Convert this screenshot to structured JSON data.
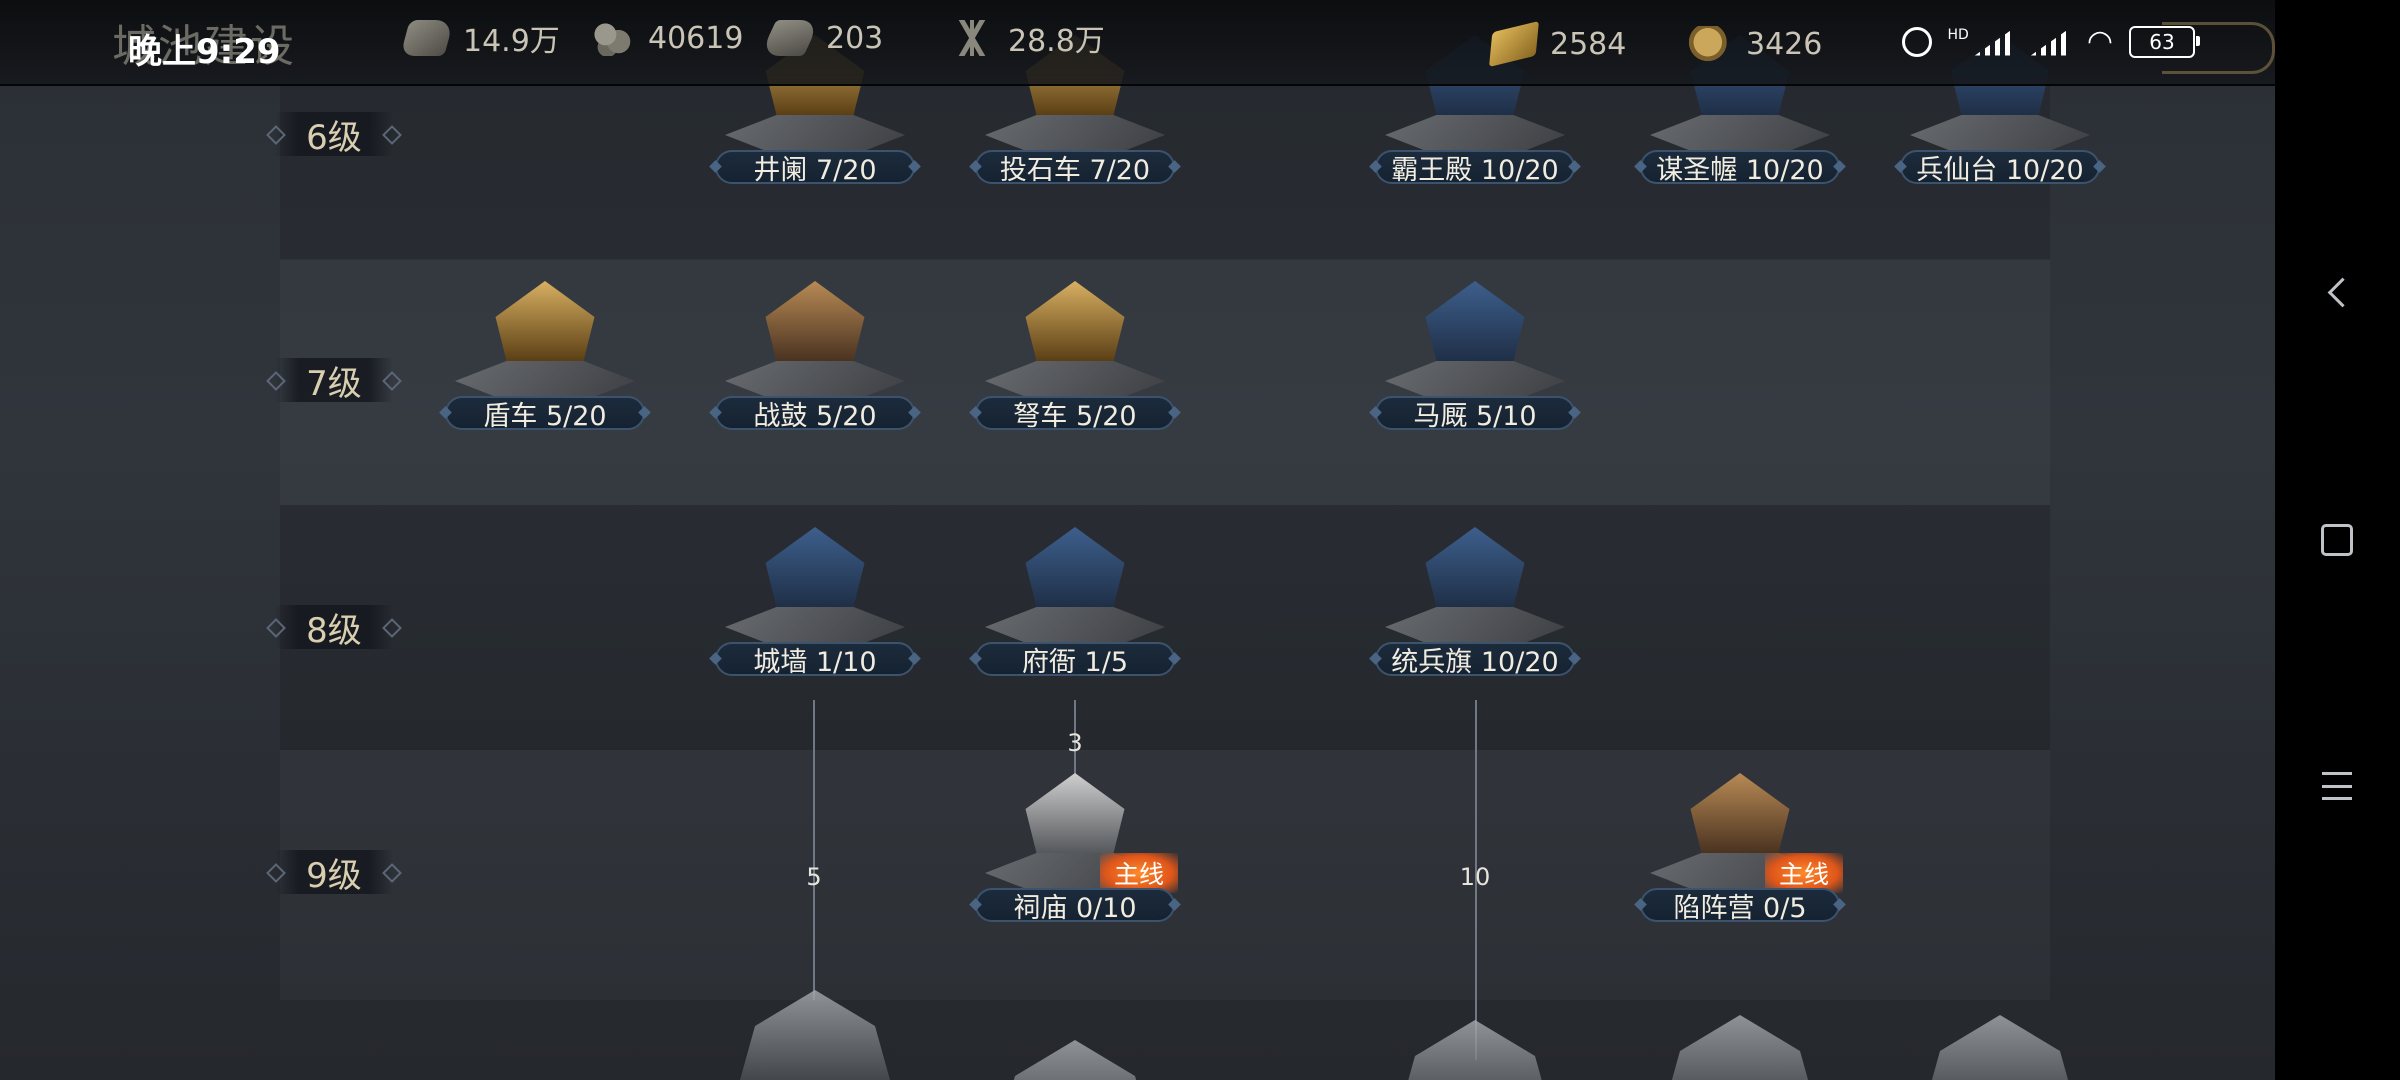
{
  "header": {
    "page_title": "城池建设",
    "time": "晚上9:29",
    "resources": [
      {
        "icon": "wood-icon",
        "value": "14.9万"
      },
      {
        "icon": "stone-icon",
        "value": "40619"
      },
      {
        "icon": "iron-icon",
        "value": "203"
      },
      {
        "icon": "grain-icon",
        "value": "28.8万"
      }
    ],
    "currencies": [
      {
        "icon": "gold-ingot-icon",
        "value": "2584"
      },
      {
        "icon": "copper-coin-icon",
        "value": "3426"
      }
    ],
    "status": {
      "hd": "HD",
      "battery": "63"
    }
  },
  "levels": [
    {
      "label": "6级"
    },
    {
      "label": "7级"
    },
    {
      "label": "8级"
    },
    {
      "label": "9级"
    }
  ],
  "buildings": {
    "lv6": [
      {
        "name": "井阑 7/20"
      },
      {
        "name": "投石车 7/20"
      },
      {
        "name": "霸王殿 10/20"
      },
      {
        "name": "谋圣幄 10/20"
      },
      {
        "name": "兵仙台 10/20"
      }
    ],
    "lv7": [
      {
        "name": "盾车 5/20"
      },
      {
        "name": "战鼓 5/20"
      },
      {
        "name": "弩车 5/20"
      },
      {
        "name": "马厩 5/10"
      }
    ],
    "lv8": [
      {
        "name": "城墙 1/10"
      },
      {
        "name": "府衙 1/5"
      },
      {
        "name": "统兵旗 10/20"
      }
    ],
    "lv9": [
      {
        "name": "祠庙 0/10",
        "tag": "主线"
      },
      {
        "name": "陷阵营 0/5",
        "tag": "主线"
      }
    ]
  },
  "requirements": [
    {
      "value": "3"
    },
    {
      "value": "5"
    },
    {
      "value": "10"
    }
  ],
  "colors": {
    "accent_orange": "#e8621d",
    "label_bg": "#152231",
    "label_border": "#3c536d"
  }
}
